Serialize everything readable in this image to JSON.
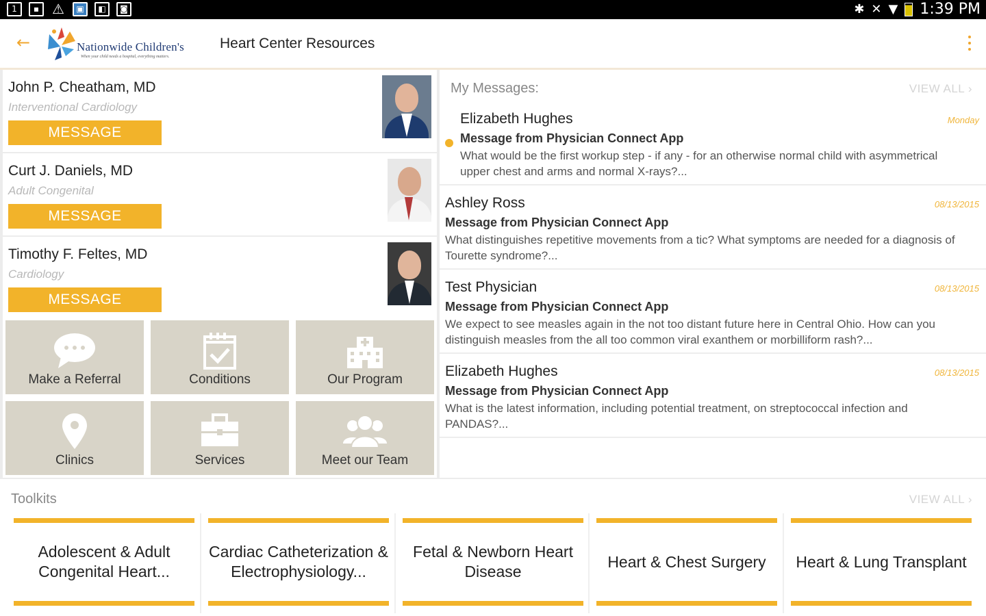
{
  "status_bar": {
    "time": "1:39 PM",
    "left_icons": [
      "app-icon",
      "image-icon",
      "warning-icon",
      "screen-icon",
      "store-icon",
      "camera-icon"
    ],
    "right_icons": [
      "bluetooth-icon",
      "mute-icon",
      "wifi-icon",
      "battery-icon"
    ]
  },
  "app_bar": {
    "title": "Heart Center Resources",
    "logo_name": "Nationwide Children's",
    "logo_tagline": "When your child needs a hospital, everything matters.",
    "accent_color": "#f0a62d"
  },
  "physicians": [
    {
      "name": "John P. Cheatham, MD",
      "specialty": "Interventional Cardiology",
      "button": "MESSAGE"
    },
    {
      "name": "Curt J. Daniels, MD",
      "specialty": "Adult Congenital",
      "button": "MESSAGE"
    },
    {
      "name": "Timothy F. Feltes, MD",
      "specialty": "Cardiology",
      "button": "MESSAGE"
    }
  ],
  "tiles": [
    {
      "label": "Make a Referral",
      "icon": "chat-bubble-icon"
    },
    {
      "label": "Conditions",
      "icon": "calendar-check-icon"
    },
    {
      "label": "Our Program",
      "icon": "hospital-icon"
    },
    {
      "label": "Clinics",
      "icon": "map-pin-icon"
    },
    {
      "label": "Services",
      "icon": "briefcase-icon"
    },
    {
      "label": "Meet our Team",
      "icon": "team-icon"
    }
  ],
  "messages": {
    "heading": "My Messages:",
    "view_all": "VIEW ALL",
    "items": [
      {
        "sender": "Elizabeth Hughes",
        "date": "Monday",
        "subject": "Message from Physician Connect App",
        "body": "What would be the first workup step - if any - for an otherwise normal child with asymmetrical upper chest and arms and normal X-rays?...",
        "unread": true
      },
      {
        "sender": "Ashley Ross",
        "date": "08/13/2015",
        "subject": "Message from Physician Connect App",
        "body": "What distinguishes repetitive movements from a tic? What symptoms are needed for a diagnosis of Tourette syndrome?...",
        "unread": false
      },
      {
        "sender": "Test Physician",
        "date": "08/13/2015",
        "subject": "Message from Physician Connect App",
        "body": "We expect to see measles again in the not too distant future here in Central Ohio. How can you distinguish measles from the all too common viral exanthem or morbilliform rash?...",
        "unread": false
      },
      {
        "sender": "Elizabeth Hughes",
        "date": "08/13/2015",
        "subject": "Message from Physician Connect App",
        "body": "What is the latest information, including potential treatment, on streptococcal infection and PANDAS?...",
        "unread": false
      }
    ]
  },
  "toolkits": {
    "heading": "Toolkits",
    "view_all": "VIEW ALL",
    "items": [
      {
        "label": "Adolescent & Adult Congenital Heart..."
      },
      {
        "label": "Cardiac Catheterization & Electrophysiology..."
      },
      {
        "label": "Fetal & Newborn Heart Disease"
      },
      {
        "label": "Heart & Chest Surgery"
      },
      {
        "label": "Heart & Lung Transplant"
      }
    ]
  }
}
